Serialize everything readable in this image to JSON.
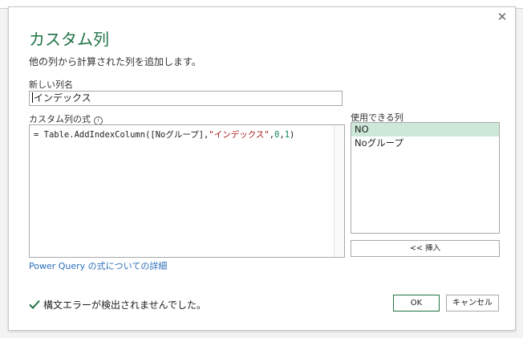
{
  "dialog": {
    "title": "カスタム列",
    "subtitle": "他の列から計算された列を追加します。",
    "close_icon": "close-icon"
  },
  "new_column": {
    "label": "新しい列名",
    "value": "インデックス"
  },
  "formula": {
    "label": "カスタム列の式",
    "info_icon": "info-icon",
    "prefix": "= Table.AddIndexColumn([Noグループ],",
    "string_arg": "\"インデックス\"",
    "sep1": ",",
    "num1": "0",
    "sep2": ",",
    "num2": "1",
    "suffix": ")"
  },
  "available_columns": {
    "label": "使用できる列",
    "items": [
      "NO",
      "Noグループ"
    ],
    "selected": "NO",
    "insert_label": "<< 挿入"
  },
  "learn_link": "Power Query の式についての詳細",
  "status": {
    "icon": "check-icon",
    "text": "構文エラーが検出されませんでした。"
  },
  "buttons": {
    "ok": "OK",
    "cancel": "キャンセル"
  },
  "colors": {
    "accent": "#217346",
    "selected_bg": "#cde8d9",
    "link": "#2a6ebb",
    "string": "#a31515",
    "number": "#09885a"
  }
}
